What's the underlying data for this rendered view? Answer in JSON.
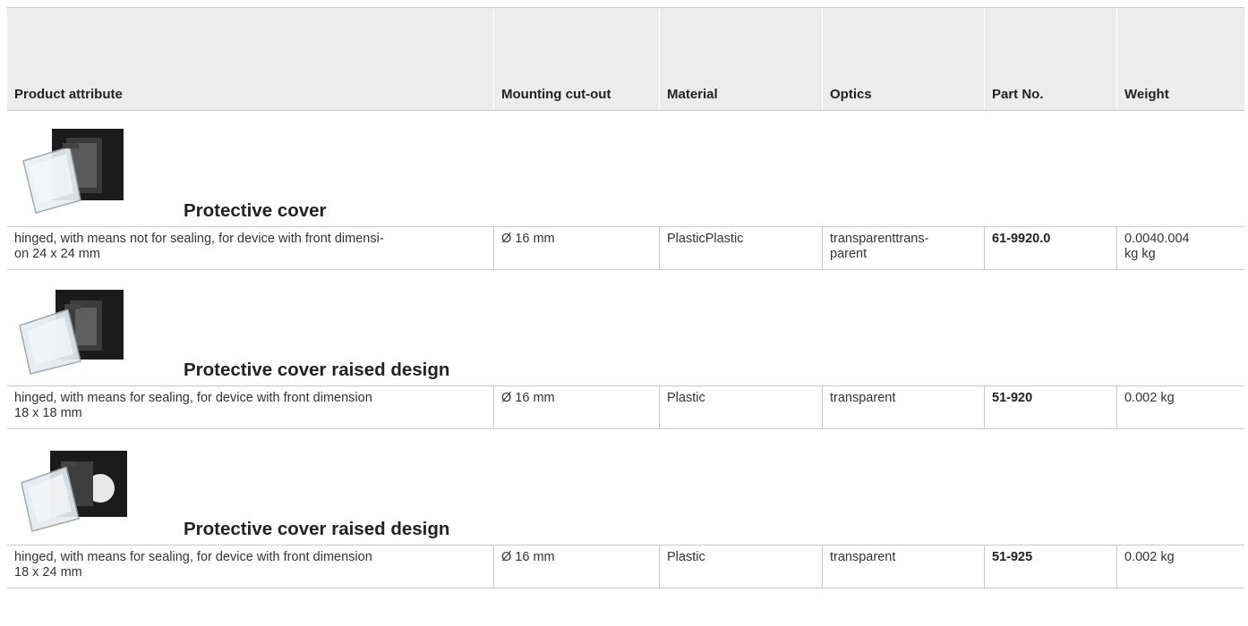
{
  "header": {
    "attribute": "Product attribute",
    "mounting": "Mounting cut-out",
    "material": "Material",
    "optics": "Optics",
    "part_no": "Part No.",
    "weight": "Weight"
  },
  "products": [
    {
      "title": "Protective cover",
      "image": "protective-cover-hinged-clear-lid",
      "attribute": "hinged, with means not for sealing, for device with front dimensi-\non 24 x 24 mm",
      "mounting": "Ø 16 mm",
      "material": "PlasticPlastic",
      "optics": "transparenttrans-\nparent",
      "part_no": "61-9920.0",
      "weight": "0.0040.004\nkg kg"
    },
    {
      "title": "Protective cover raised design",
      "image": "protective-cover-raised-18x18",
      "attribute": "hinged, with means for sealing, for device with front dimension\n18 x 18 mm",
      "mounting": "Ø 16 mm",
      "material": "Plastic",
      "optics": "transparent",
      "part_no": "51-920",
      "weight": "0.002 kg"
    },
    {
      "title": "Protective cover raised design",
      "image": "protective-cover-raised-18x24",
      "attribute": "hinged, with means for sealing, for device with front dimension\n18 x 24 mm",
      "mounting": "Ø 16 mm",
      "material": "Plastic",
      "optics": "transparent",
      "part_no": "51-925",
      "weight": "0.002 kg"
    }
  ]
}
